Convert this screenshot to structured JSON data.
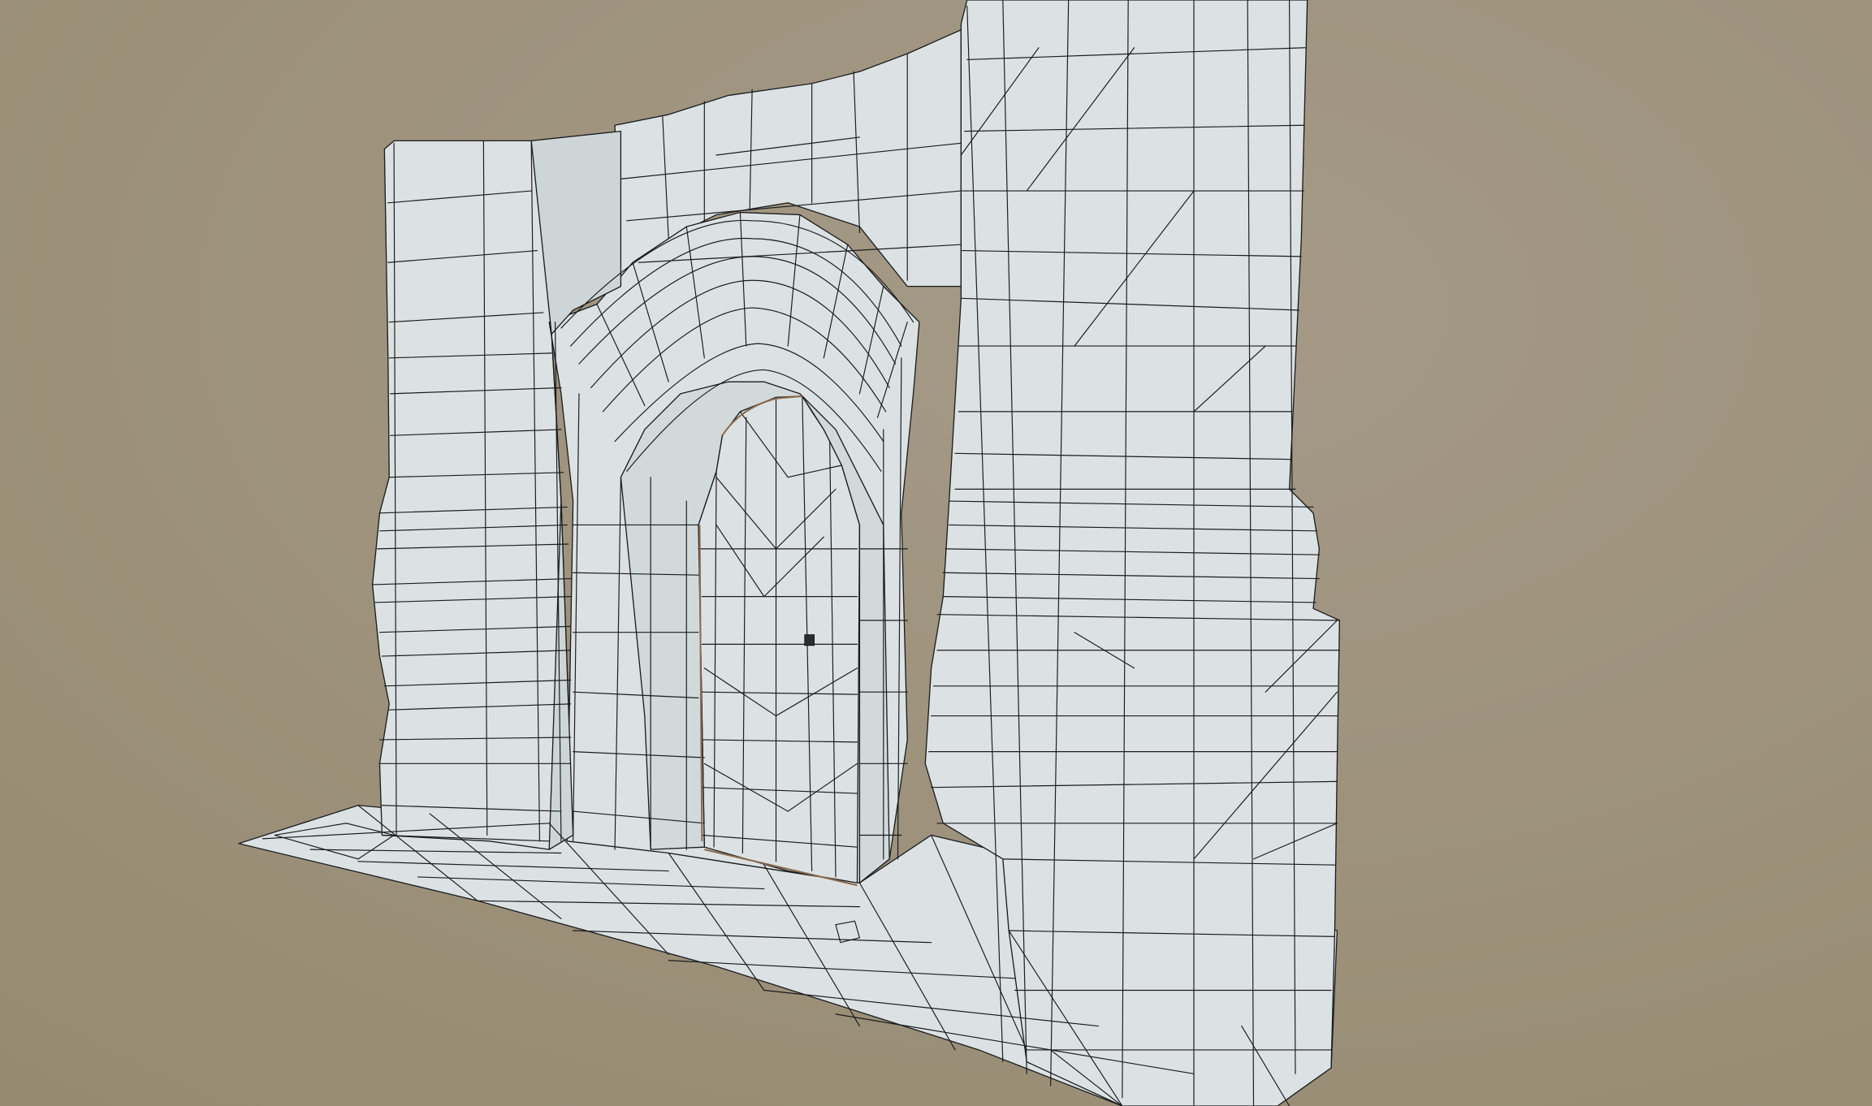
{
  "scene": {
    "subject": "",
    "colors": {
      "background_center": "#a59a86",
      "background_edge": "#968a72",
      "mesh_fill": "#dce2e3",
      "mesh_shade": "#c9d0d2",
      "wire": "#1a1c1e",
      "frame_accent": "#8a6a4e"
    },
    "render_mode": "wireframe-on-shaded"
  }
}
